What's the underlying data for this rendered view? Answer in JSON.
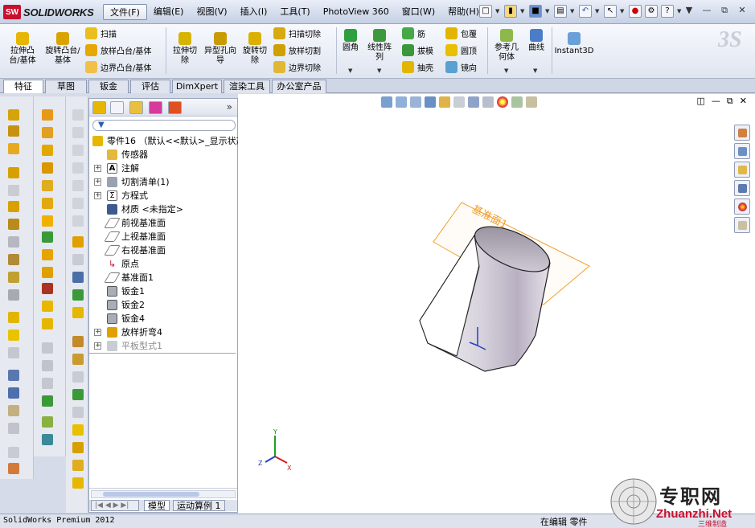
{
  "app": {
    "logo": "SW",
    "brand": "SOLIDWORKS"
  },
  "menu": [
    "文件(F)",
    "编辑(E)",
    "视图(V)",
    "插入(I)",
    "工具(T)",
    "PhotoView 360",
    "窗口(W)",
    "帮助(H)"
  ],
  "command_manager": {
    "extrude_boss": "拉伸凸台/基体",
    "revolve_boss": "旋转凸台/基体",
    "sweep": "扫描",
    "loft_boss": "放样凸台/基体",
    "boundary_boss": "边界凸台/基体",
    "extrude_cut": "拉伸切除",
    "hole_wizard": "异型孔向导",
    "revolve_cut": "旋转切除",
    "swept_cut": "扫描切除",
    "lofted_cut": "放样切割",
    "boundary_cut": "边界切除",
    "fillet": "圆角",
    "linear_pattern": "线性阵列",
    "rib": "筋",
    "draft": "拔模",
    "shell": "抽壳",
    "wrap": "包覆",
    "dome": "圆顶",
    "mirror": "镜向",
    "ref_geometry": "参考几何体",
    "curves": "曲线",
    "instant3d": "Instant3D"
  },
  "tabs": [
    "特征",
    "草图",
    "钣金",
    "评估",
    "DimXpert",
    "渲染工具",
    "办公室产品"
  ],
  "feature_tree": {
    "root": "零件16 （默认<<默认>_显示状态",
    "items": [
      {
        "label": "传感器",
        "icon": "sensor-icon",
        "expandable": false
      },
      {
        "label": "注解",
        "icon": "annotation-icon",
        "expandable": true
      },
      {
        "label": "切割清单(1)",
        "icon": "cutlist-icon",
        "expandable": true
      },
      {
        "label": "方程式",
        "icon": "equation-icon",
        "expandable": true
      },
      {
        "label": "材质 <未指定>",
        "icon": "material-icon",
        "expandable": false
      },
      {
        "label": "前视基准面",
        "icon": "plane-icon",
        "expandable": false
      },
      {
        "label": "上视基准面",
        "icon": "plane-icon",
        "expandable": false
      },
      {
        "label": "右视基准面",
        "icon": "plane-icon",
        "expandable": false
      },
      {
        "label": "原点",
        "icon": "origin-icon",
        "expandable": false
      },
      {
        "label": "基准面1",
        "icon": "plane-icon",
        "expandable": false
      },
      {
        "label": "钣金1",
        "icon": "sheetmetal-icon",
        "expandable": false
      },
      {
        "label": "钣金2",
        "icon": "sheetmetal-icon",
        "expandable": false
      },
      {
        "label": "钣金4",
        "icon": "sheetmetal-icon",
        "expandable": false
      },
      {
        "label": "放样折弯4",
        "icon": "lofted-bend-icon",
        "expandable": true
      },
      {
        "label": "平板型式1",
        "icon": "flat-pattern-icon",
        "expandable": true,
        "suppressed": true
      }
    ]
  },
  "bottom_tabs": [
    "模型",
    "运动算例 1"
  ],
  "graphics": {
    "plane_label": "基准面1",
    "axes": {
      "x": "X",
      "y": "Y",
      "z": "Z"
    }
  },
  "status": {
    "text": "SolidWorks Premium 2012",
    "mode": "在编辑 零件"
  },
  "watermark": {
    "cn": "专职网",
    "url": "Zhuanzhi.Net",
    "sub": "三维制造"
  },
  "colors": {
    "accent_orange": "#f0a030",
    "part_gray": "#d8d4dc",
    "cmd_blue": "#2d5fb0"
  }
}
